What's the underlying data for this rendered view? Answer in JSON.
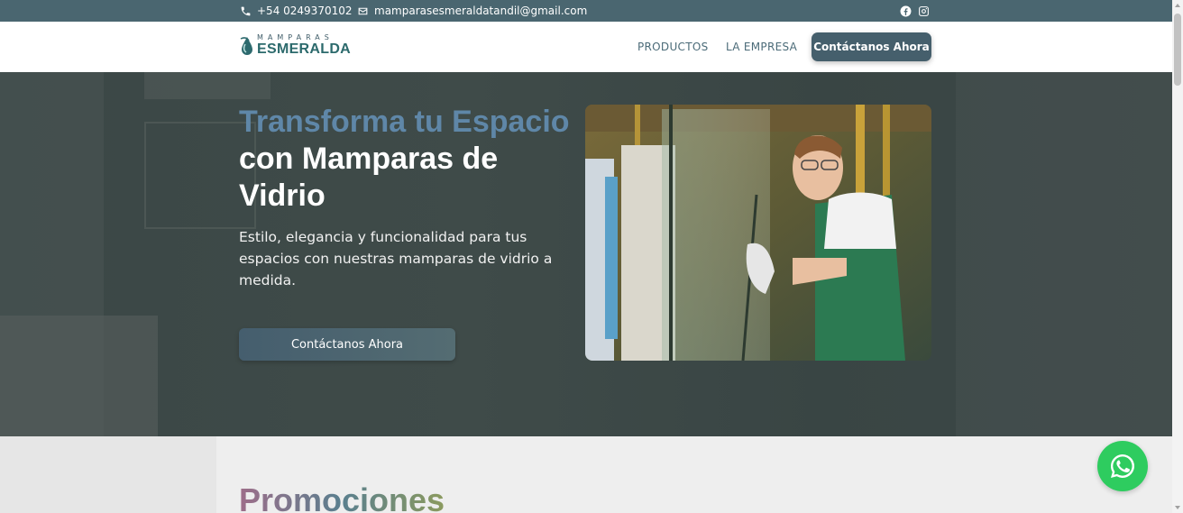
{
  "topbar": {
    "phone": "+54 0249370102",
    "email": "mamparasesmeraldatandil@gmail.com",
    "icons": [
      "phone-icon",
      "mail-icon",
      "facebook-icon",
      "instagram-icon"
    ]
  },
  "logo": {
    "top_text": "MAMPARAS",
    "brand": "ESMERALDA"
  },
  "nav": {
    "links": [
      "PRODUCTOS",
      "LA EMPRESA"
    ],
    "cta": "Contáctanos Ahora"
  },
  "hero": {
    "title_accent": "Transforma tu Espacio",
    "title_rest": " con Mamparas de Vidrio",
    "subtitle": "Estilo, elegancia y funcionalidad para tus espacios con nuestras mamparas de vidrio a medida.",
    "button": "Contáctanos Ahora"
  },
  "promo": {
    "title": "Promociones"
  },
  "colors": {
    "topbar": "#4a6670",
    "accent": "#5f87a8",
    "button": "#455f6c",
    "whatsapp": "#2ecc5f"
  }
}
